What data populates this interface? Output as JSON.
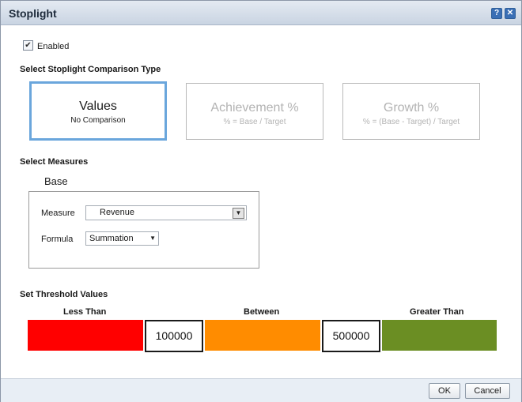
{
  "dialog": {
    "title": "Stoplight",
    "help_icon": "help-icon",
    "close_icon": "close-icon"
  },
  "enabled": {
    "label": "Enabled",
    "checked": true
  },
  "comparison": {
    "section_label": "Select Stoplight Comparison Type",
    "options": [
      {
        "title": "Values",
        "subtitle": "No Comparison",
        "selected": true
      },
      {
        "title": "Achievement %",
        "subtitle": "% = Base / Target",
        "selected": false
      },
      {
        "title": "Growth %",
        "subtitle": "% = (Base - Target) / Target",
        "selected": false
      }
    ]
  },
  "measures": {
    "section_label": "Select Measures",
    "group_label": "Base",
    "measure_label": "Measure",
    "measure_value": "Revenue",
    "formula_label": "Formula",
    "formula_value": "Summation"
  },
  "threshold": {
    "section_label": "Set Threshold Values",
    "less_than_label": "Less Than",
    "between_label": "Between",
    "greater_than_label": "Greater Than",
    "low_value": "100000",
    "high_value": "500000",
    "colors": {
      "low": "#ff0000",
      "mid": "#ff8c00",
      "high": "#6b8e23"
    }
  },
  "buttons": {
    "ok": "OK",
    "cancel": "Cancel"
  }
}
